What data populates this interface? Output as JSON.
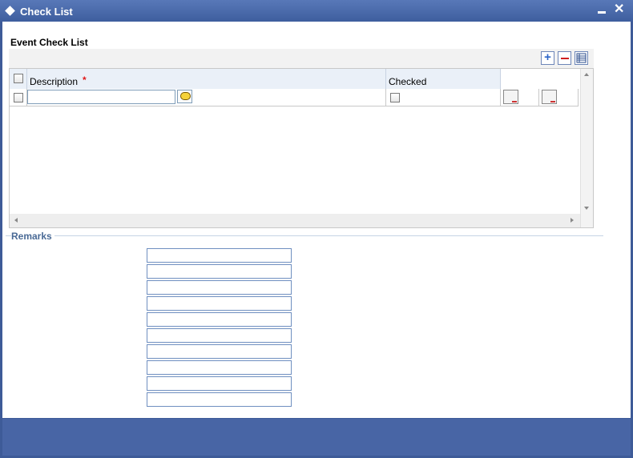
{
  "window": {
    "title": "Check List"
  },
  "section": {
    "title": "Event Check List"
  },
  "grid": {
    "columns": {
      "description": "Description",
      "required_marker": "*",
      "checked": "Checked"
    },
    "rows": [
      {
        "description": "",
        "checked": false
      }
    ]
  },
  "remarks": {
    "legend": "Remarks",
    "fields": [
      "",
      "",
      "",
      "",
      "",
      "",
      "",
      "",
      "",
      ""
    ]
  }
}
